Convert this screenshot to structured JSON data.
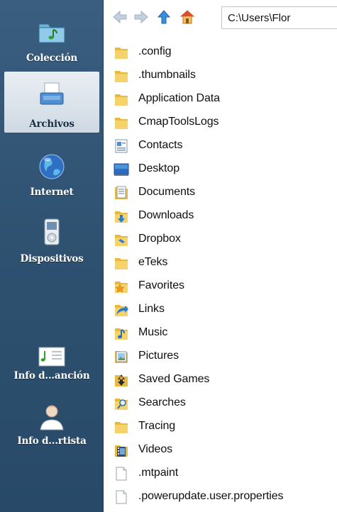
{
  "sidebar": {
    "items": [
      {
        "label": "Colección",
        "icon": "music-folder-icon",
        "active": false
      },
      {
        "label": "Archivos",
        "icon": "file-tray-icon",
        "active": true
      },
      {
        "label": "Internet",
        "icon": "globe-icon",
        "active": false
      },
      {
        "label": "Dispositivos",
        "icon": "ipod-device-icon",
        "active": false
      },
      {
        "label": "Info d...anción",
        "icon": "song-info-icon",
        "active": false
      },
      {
        "label": "Info d...rtista",
        "icon": "artist-person-icon",
        "active": false
      }
    ]
  },
  "toolbar": {
    "back_icon": "arrow-left-icon",
    "forward_icon": "arrow-right-icon",
    "up_icon": "arrow-up-icon",
    "home_icon": "home-icon",
    "path_value": "C:\\Users\\Flor"
  },
  "files": [
    {
      "name": ".config",
      "icon": "folder-icon"
    },
    {
      "name": ".thumbnails",
      "icon": "folder-icon"
    },
    {
      "name": "Application Data",
      "icon": "folder-icon"
    },
    {
      "name": "CmapToolsLogs",
      "icon": "folder-icon"
    },
    {
      "name": "Contacts",
      "icon": "contacts-icon"
    },
    {
      "name": "Desktop",
      "icon": "desktop-icon"
    },
    {
      "name": "Documents",
      "icon": "documents-icon"
    },
    {
      "name": "Downloads",
      "icon": "downloads-icon"
    },
    {
      "name": "Dropbox",
      "icon": "dropbox-folder-icon"
    },
    {
      "name": "eTeks",
      "icon": "folder-icon"
    },
    {
      "name": "Favorites",
      "icon": "favorites-icon"
    },
    {
      "name": "Links",
      "icon": "links-icon"
    },
    {
      "name": "Music",
      "icon": "music-folder-icon"
    },
    {
      "name": "Pictures",
      "icon": "pictures-icon"
    },
    {
      "name": "Saved Games",
      "icon": "saved-games-icon"
    },
    {
      "name": "Searches",
      "icon": "searches-icon"
    },
    {
      "name": "Tracing",
      "icon": "folder-icon"
    },
    {
      "name": "Videos",
      "icon": "videos-icon"
    },
    {
      "name": ".mtpaint",
      "icon": "file-icon"
    },
    {
      "name": ".powerupdate.user.properties",
      "icon": "file-icon"
    }
  ],
  "colors": {
    "sidebar_bg": "#2e5170",
    "sidebar_active_bg": "#dde5ec",
    "folder_yellow": "#f2c94c",
    "nav_arrow_active": "#3b8ed8",
    "nav_arrow_disabled": "#b9c7d4"
  }
}
